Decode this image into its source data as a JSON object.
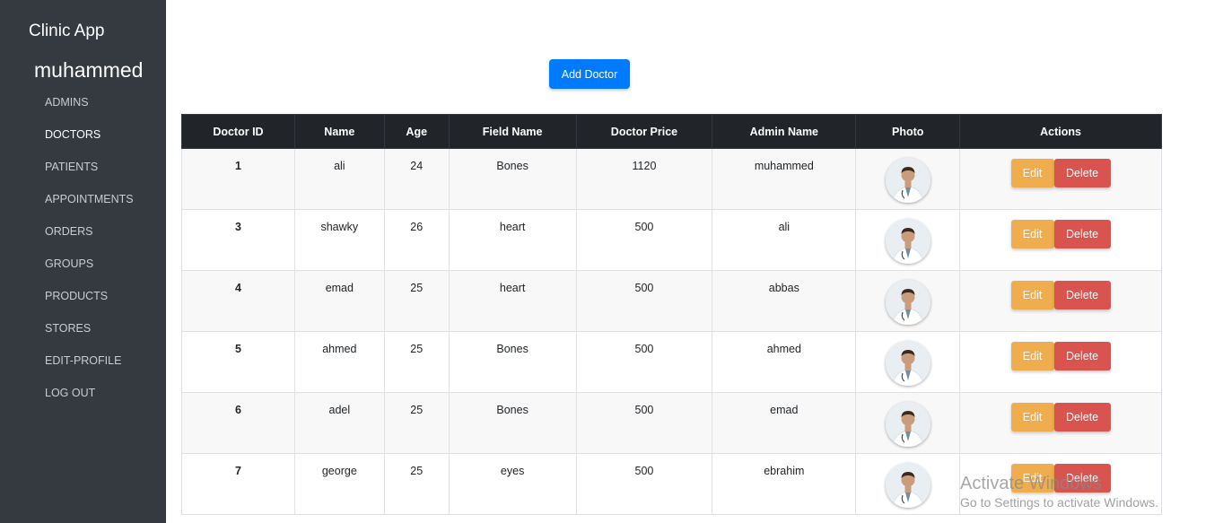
{
  "sidebar": {
    "brand": "Clinic App",
    "user": "muhammed",
    "items": [
      {
        "label": "ADMINS",
        "active": false
      },
      {
        "label": "DOCTORS",
        "active": true
      },
      {
        "label": "PATIENTS",
        "active": false
      },
      {
        "label": "APPOINTMENTS",
        "active": false
      },
      {
        "label": "ORDERS",
        "active": false
      },
      {
        "label": "GROUPS",
        "active": false
      },
      {
        "label": "PRODUCTS",
        "active": false
      },
      {
        "label": "STORES",
        "active": false
      },
      {
        "label": "EDIT-PROFILE",
        "active": false
      },
      {
        "label": "LOG OUT",
        "active": false
      }
    ]
  },
  "main": {
    "add_button_label": "Add Doctor",
    "table": {
      "headers": [
        "Doctor ID",
        "Name",
        "Age",
        "Field Name",
        "Doctor Price",
        "Admin Name",
        "Photo",
        "Actions"
      ],
      "rows": [
        {
          "id": "1",
          "name": "ali",
          "age": "24",
          "field": "Bones",
          "price": "1120",
          "admin": "muhammed",
          "photo_icon": "doctor-photo",
          "edit": "Edit",
          "delete": "Delete"
        },
        {
          "id": "3",
          "name": "shawky",
          "age": "26",
          "field": "heart",
          "price": "500",
          "admin": "ali",
          "photo_icon": "doctor-photo",
          "edit": "Edit",
          "delete": "Delete"
        },
        {
          "id": "4",
          "name": "emad",
          "age": "25",
          "field": "heart",
          "price": "500",
          "admin": "abbas",
          "photo_icon": "doctor-photo",
          "edit": "Edit",
          "delete": "Delete"
        },
        {
          "id": "5",
          "name": "ahmed",
          "age": "25",
          "field": "Bones",
          "price": "500",
          "admin": "ahmed",
          "photo_icon": "doctor-photo",
          "edit": "Edit",
          "delete": "Delete"
        },
        {
          "id": "6",
          "name": "adel",
          "age": "25",
          "field": "Bones",
          "price": "500",
          "admin": "emad",
          "photo_icon": "doctor-photo",
          "edit": "Edit",
          "delete": "Delete"
        },
        {
          "id": "7",
          "name": "george",
          "age": "25",
          "field": "eyes",
          "price": "500",
          "admin": "ebrahim",
          "photo_icon": "doctor-photo",
          "edit": "Edit",
          "delete": "Delete"
        }
      ]
    }
  },
  "watermark": {
    "title": "Activate Windows",
    "subtitle": "Go to Settings to activate Windows."
  },
  "colors": {
    "sidebar_bg": "#343a40",
    "primary": "#007bff",
    "table_header_bg": "#212529",
    "edit": "#f0ad4e",
    "delete": "#d9534f"
  }
}
